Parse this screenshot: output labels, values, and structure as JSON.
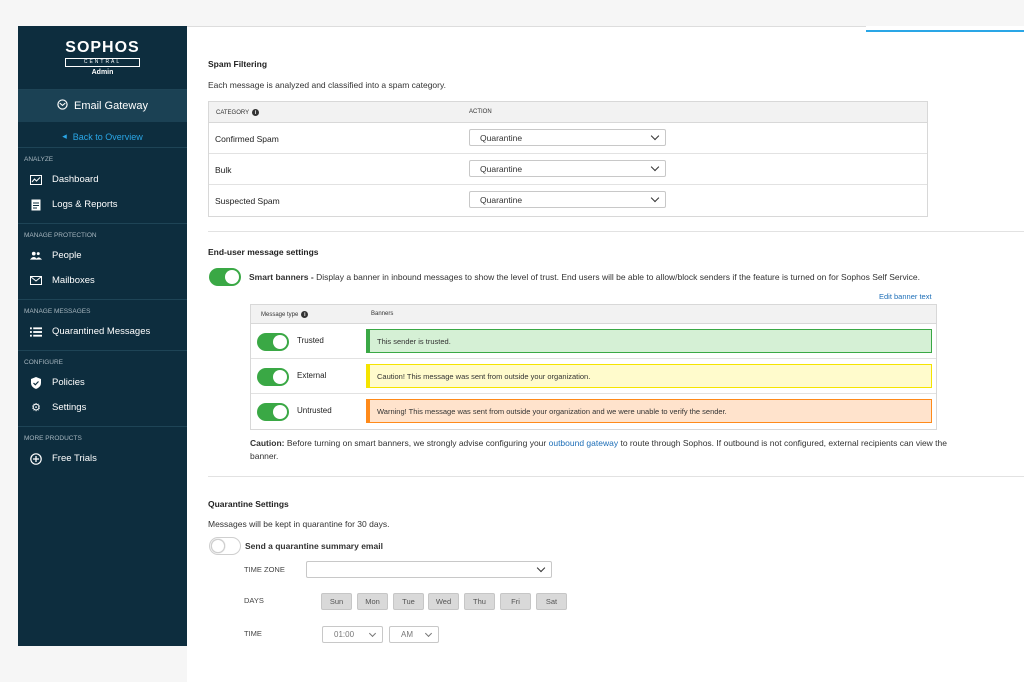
{
  "sidebar": {
    "logo": "SOPHOS",
    "logo_sub": "CENTRAL",
    "logo_admin": "Admin",
    "product": "Email Gateway",
    "back": "Back to Overview",
    "sections": {
      "analyze": "ANALYZE",
      "manage_protection": "MANAGE PROTECTION",
      "manage_messages": "MANAGE MESSAGES",
      "configure": "CONFIGURE",
      "more_products": "MORE PRODUCTS"
    },
    "items": {
      "dashboard": "Dashboard",
      "logs": "Logs & Reports",
      "people": "People",
      "mailboxes": "Mailboxes",
      "quarantined": "Quarantined Messages",
      "policies": "Policies",
      "settings": "Settings",
      "free_trials": "Free Trials"
    }
  },
  "spam": {
    "title": "Spam Filtering",
    "description": "Each message is analyzed and classified into a spam category.",
    "col_category": "CATEGORY",
    "col_action": "ACTION",
    "rows": [
      {
        "category": "Confirmed Spam",
        "action": "Quarantine"
      },
      {
        "category": "Bulk",
        "action": "Quarantine"
      },
      {
        "category": "Suspected Spam",
        "action": "Quarantine"
      }
    ]
  },
  "enduser": {
    "title": "End-user message settings",
    "smart_banners_label": "Smart banners -",
    "smart_banners_desc": "Display a banner in inbound messages to show the level of trust. End users will be able to allow/block senders if the feature is turned on for Sophos Self Service.",
    "edit_link": "Edit banner text",
    "col_type": "Message type",
    "col_banners": "Banners",
    "rows": [
      {
        "type": "Trusted",
        "banner": "This sender is trusted."
      },
      {
        "type": "External",
        "banner": "Caution! This message was sent from outside your organization."
      },
      {
        "type": "Untrusted",
        "banner": "Warning! This message was sent from outside your organization and we were unable to verify the sender."
      }
    ],
    "caution_label": "Caution:",
    "caution_text_1": "Before turning on smart banners, we strongly advise configuring your",
    "caution_link": "outbound gateway",
    "caution_text_2": "to route through Sophos. If outbound is not configured, external",
    "caution_text_3": "recipients can view the banner."
  },
  "quarantine": {
    "title": "Quarantine Settings",
    "description": "Messages will be kept in quarantine for 30 days.",
    "summary_label": "Send a quarantine summary email",
    "timezone_label": "TIME ZONE",
    "timezone_value": "",
    "days_label": "DAYS",
    "days": [
      "Sun",
      "Mon",
      "Tue",
      "Wed",
      "Thu",
      "Fri",
      "Sat"
    ],
    "time_label": "TIME",
    "time_value": "01:00",
    "ampm_value": "AM"
  },
  "colors": {
    "sidebar_bg": "#0d2d3e",
    "accent": "#2aa6e6",
    "toggle_on": "#3aa845",
    "trusted_bg": "#d5f0d5",
    "trusted_border": "#3aa845",
    "external_bg": "#fffbcc",
    "external_border": "#f5e400",
    "untrusted_bg": "#ffe3cc",
    "untrusted_border": "#ff8a1a"
  }
}
